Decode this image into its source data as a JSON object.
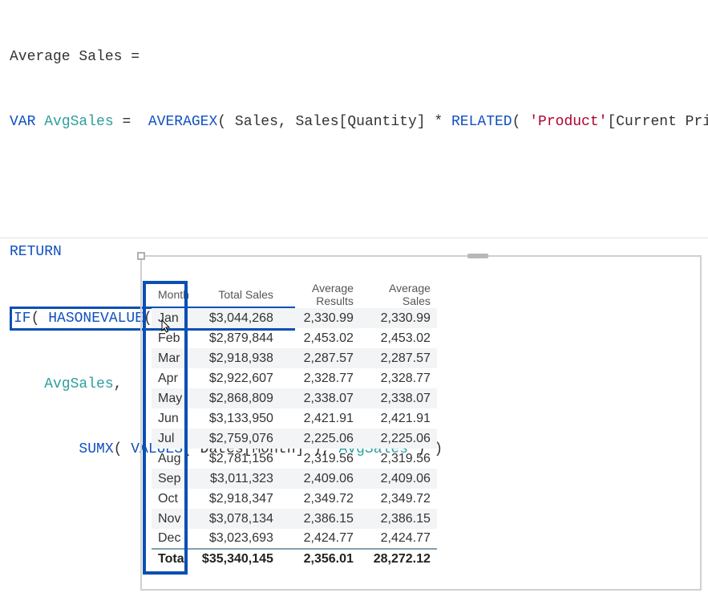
{
  "formula": {
    "measure_name": "Average Sales",
    "eq": "=",
    "kw_var": "VAR",
    "var_name": "AvgSales",
    "fn_averagex": "AVERAGEX",
    "tbl_sales": "Sales",
    "col_qty": "Sales[Quantity]",
    "op_mul": "*",
    "fn_related": "RELATED",
    "str_product": "'Product'",
    "col_price": "[Current Price]",
    "kw_return": "RETURN",
    "fn_if": "IF",
    "fn_hasonevalue": "HASONEVALUE",
    "col_month": "Dates[Month]",
    "fn_sumx": "SUMX",
    "fn_values": "VALUES"
  },
  "table": {
    "headers": [
      "Month",
      "Total Sales",
      "Average Results",
      "Average Sales"
    ],
    "rows": [
      [
        "Jan",
        "$3,044,268",
        "2,330.99",
        "2,330.99"
      ],
      [
        "Feb",
        "$2,879,844",
        "2,453.02",
        "2,453.02"
      ],
      [
        "Mar",
        "$2,918,938",
        "2,287.57",
        "2,287.57"
      ],
      [
        "Apr",
        "$2,922,607",
        "2,328.77",
        "2,328.77"
      ],
      [
        "May",
        "$2,868,809",
        "2,338.07",
        "2,338.07"
      ],
      [
        "Jun",
        "$3,133,950",
        "2,421.91",
        "2,421.91"
      ],
      [
        "Jul",
        "$2,759,076",
        "2,225.06",
        "2,225.06"
      ],
      [
        "Aug",
        "$2,781,156",
        "2,319.56",
        "2,319.56"
      ],
      [
        "Sep",
        "$3,011,323",
        "2,409.06",
        "2,409.06"
      ],
      [
        "Oct",
        "$2,918,347",
        "2,349.72",
        "2,349.72"
      ],
      [
        "Nov",
        "$3,078,134",
        "2,386.15",
        "2,386.15"
      ],
      [
        "Dec",
        "$3,023,693",
        "2,424.77",
        "2,424.77"
      ]
    ],
    "total": [
      "Total",
      "$35,340,145",
      "2,356.01",
      "28,272.12"
    ]
  }
}
